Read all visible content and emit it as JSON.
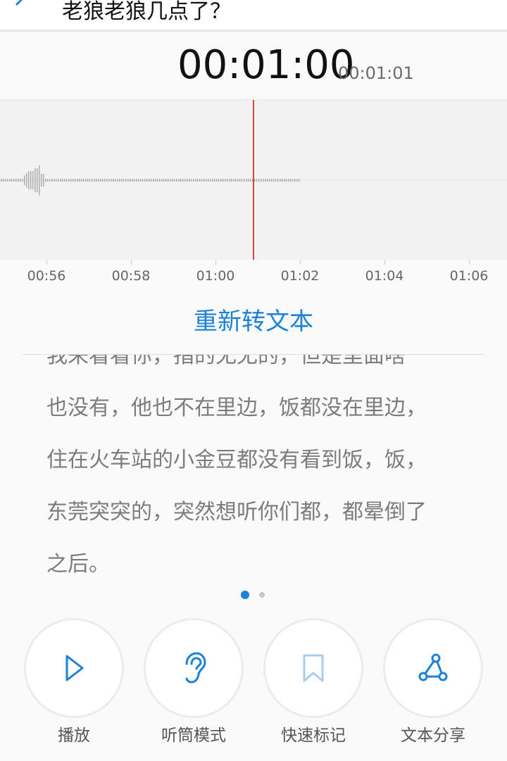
{
  "header": {
    "title": "老狼老狼几点了？"
  },
  "timer": {
    "current": "00:01:00",
    "total": "00:01:01"
  },
  "timeline": {
    "ticks": [
      "00:56",
      "00:58",
      "01:00",
      "01:02",
      "01:04",
      "01:06"
    ]
  },
  "reconvert_label": "重新转文本",
  "transcript": {
    "lines": [
      "我来看看你，指的无无的，但是里面啥",
      "也没有，他也不在里边，饭都没在里边，",
      "住在火车站的小金豆都没有看到饭，饭，",
      "东莞突突的，突然想听你们都，都晕倒了",
      "之后。"
    ]
  },
  "actions": [
    {
      "label": "播放",
      "icon": "play-icon"
    },
    {
      "label": "听筒模式",
      "icon": "ear-icon"
    },
    {
      "label": "快速标记",
      "icon": "bookmark-icon"
    },
    {
      "label": "文本分享",
      "icon": "share-icon"
    }
  ],
  "pager": {
    "active_index": 0,
    "count": 2
  },
  "colors": {
    "accent": "#1a82d8",
    "playhead": "#d9493a",
    "text_muted": "#7c7c7c"
  }
}
